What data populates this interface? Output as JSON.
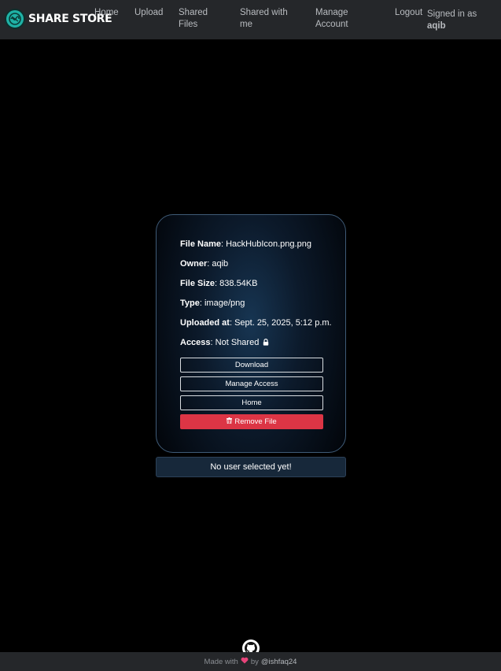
{
  "navbar": {
    "brand": "SHARE STORE",
    "links": {
      "home": "Home",
      "upload": "Upload",
      "shared_files": "Shared Files",
      "shared_with_me": "Shared with me",
      "manage_account": "Manage Account",
      "logout": "Logout"
    },
    "signed_in_label": "Signed in as",
    "username": "aqib"
  },
  "file": {
    "name_label": "File Name",
    "name": "HackHubIcon.png.png",
    "owner_label": "Owner",
    "owner": "aqib",
    "size_label": "File Size",
    "size": "838.54KB",
    "type_label": "Type",
    "type": "image/png",
    "uploaded_label": "Uploaded at",
    "uploaded": "Sept. 25, 2025, 5:12 p.m.",
    "access_label": "Access",
    "access": "Not Shared",
    "access_icon": "lock-icon"
  },
  "actions": {
    "download": "Download",
    "manage_access": "Manage Access",
    "home": "Home",
    "remove": "Remove File",
    "remove_icon": "trash-icon"
  },
  "selected_user": "No user selected yet!",
  "footer": {
    "made_with": "Made with",
    "by": "by",
    "handle": "@ishfaq24",
    "github_icon": "github-icon",
    "heart_icon": "heart-icon"
  },
  "colors": {
    "navbar_bg": "#25272a",
    "danger": "#dc3545",
    "brand_logo": "#1fb2a6",
    "page_bg": "#000000"
  }
}
